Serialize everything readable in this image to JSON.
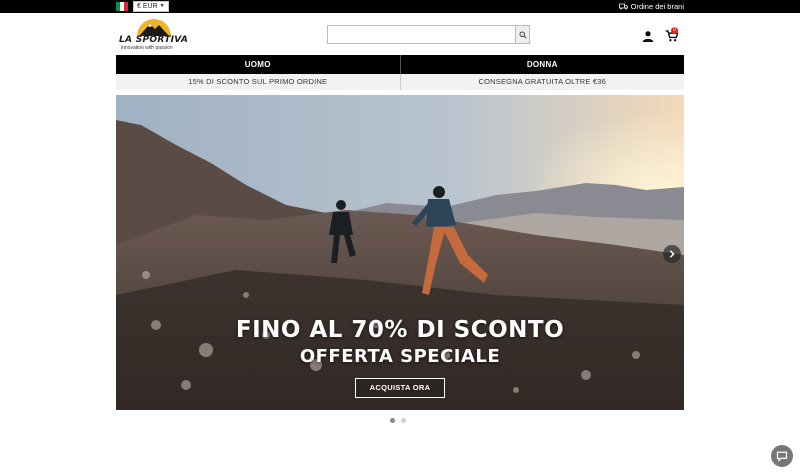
{
  "topbar": {
    "flag_colors": [
      "#009246",
      "#ffffff",
      "#ce2b37"
    ],
    "currency": "€ EUR",
    "order_link": "Ordine dei brani"
  },
  "logo": {
    "name": "LA SPORTIVA",
    "tagline": "innovation with passion"
  },
  "search": {
    "placeholder": "",
    "value": ""
  },
  "cart": {
    "count": "0"
  },
  "categories": [
    "UOMO",
    "DONNA"
  ],
  "promos": [
    "15% DI SCONTO SUL PRIMO ORDINE",
    "CONSEGNA GRATUITA OLTRE €36"
  ],
  "hero": {
    "title": "FINO AL 70% DI SCONTO",
    "subtitle": "OFFERTA SPECIALE",
    "cta": "ACQUISTA ORA",
    "slide_count": 2,
    "active_slide": 1
  },
  "colors": {
    "accent_logo": "#f0b429",
    "badge": "#e2231a",
    "bar": "#000000"
  },
  "icons": [
    "truck-icon",
    "search-icon",
    "user-icon",
    "cart-icon",
    "chevron-right-icon",
    "chat-icon"
  ]
}
